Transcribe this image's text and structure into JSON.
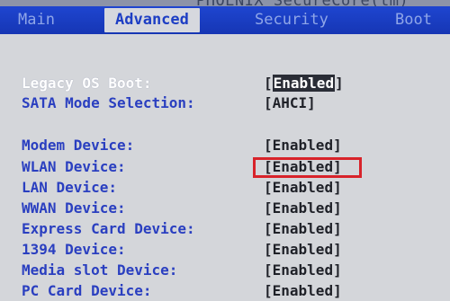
{
  "header": {
    "vendor_title": "PHOENIX SecureCore(tm)"
  },
  "tabs": [
    {
      "label": "Main",
      "active": false
    },
    {
      "label": "Advanced",
      "active": true
    },
    {
      "label": "Security",
      "active": false
    },
    {
      "label": "Boot",
      "active": false
    }
  ],
  "settings": [
    {
      "label": "Legacy OS Boot:",
      "bracket_open": "[",
      "value": "Enabled",
      "bracket_close": "]",
      "selected": true
    },
    {
      "label": "SATA Mode Selection:",
      "bracket_open": "[",
      "value": "AHCI",
      "bracket_close": "]"
    },
    {
      "label": "Modem Device:",
      "bracket_open": "[",
      "value": "Enabled",
      "bracket_close": "]"
    },
    {
      "label": "WLAN Device:",
      "bracket_open": "[",
      "value": "Enabled",
      "bracket_close": "]",
      "highlighted": true
    },
    {
      "label": "LAN Device:",
      "bracket_open": "[",
      "value": "Enabled",
      "bracket_close": "]"
    },
    {
      "label": "WWAN Device:",
      "bracket_open": "[",
      "value": "Enabled",
      "bracket_close": "]"
    },
    {
      "label": "Express Card Device:",
      "bracket_open": "[",
      "value": "Enabled",
      "bracket_close": "]"
    },
    {
      "label": "1394 Device:",
      "bracket_open": "[",
      "value": "Enabled",
      "bracket_close": "]"
    },
    {
      "label": "Media slot Device:",
      "bracket_open": "[",
      "value": "Enabled",
      "bracket_close": "]"
    },
    {
      "label": "PC Card Device:",
      "bracket_open": "[",
      "value": "Enabled",
      "bracket_close": "]"
    }
  ],
  "colors": {
    "tab_bar": "#1636b4",
    "active_tab_text": "#1d3ec4",
    "label_text": "#2a3fc0",
    "highlight_box": "#d8232a"
  }
}
